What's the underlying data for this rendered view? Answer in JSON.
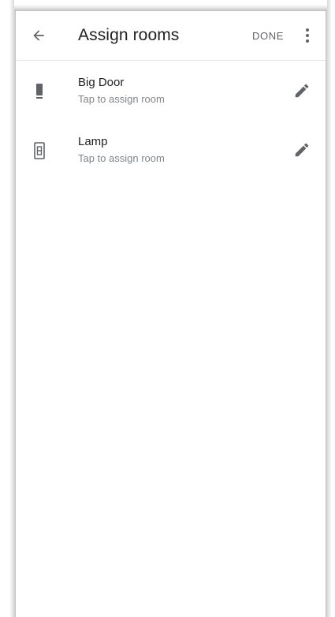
{
  "toolbar": {
    "title": "Assign rooms",
    "done_label": "DONE",
    "back_icon": "arrow-back-icon",
    "more_icon": "more-vert-icon"
  },
  "devices": [
    {
      "name": "Big Door",
      "subtitle": "Tap to assign room",
      "icon": "door-sensor-icon",
      "action_icon": "edit-pencil-icon"
    },
    {
      "name": "Lamp",
      "subtitle": "Tap to assign room",
      "icon": "switch-icon",
      "action_icon": "edit-pencil-icon"
    }
  ],
  "colors": {
    "text_primary": "#202124",
    "text_secondary": "#80868b",
    "icon": "#5f6368"
  }
}
